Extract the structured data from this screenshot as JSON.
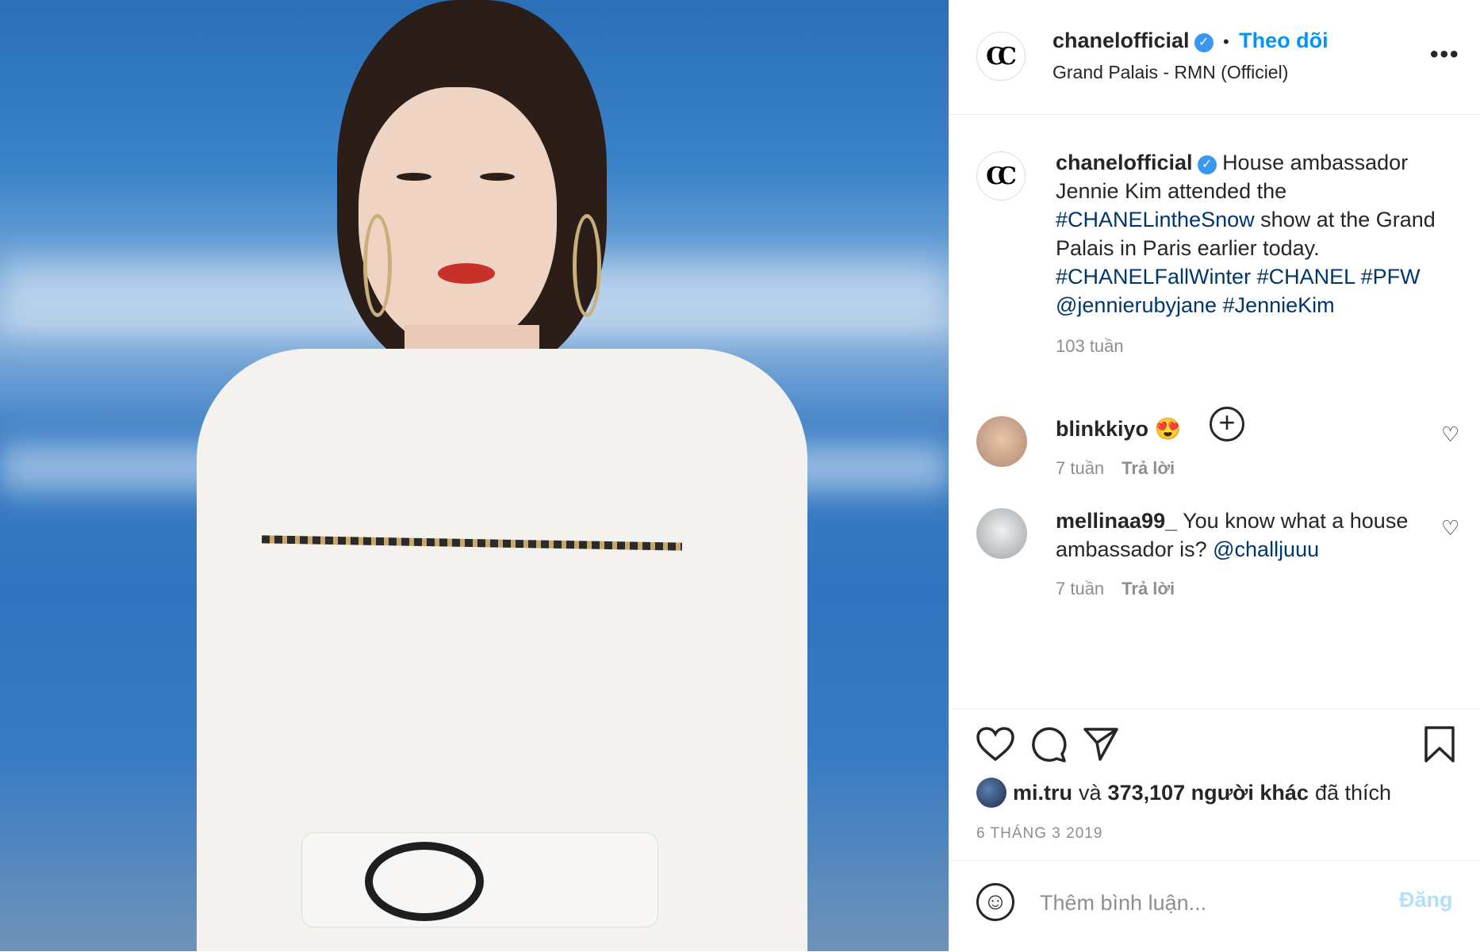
{
  "post": {
    "image_alt": "",
    "header": {
      "username": "chanelofficial",
      "separator": "•",
      "follow_label": "Theo dõi",
      "location": "Grand Palais - RMN (Officiel)",
      "more": "•••",
      "avatar_glyph": "CC"
    },
    "caption": {
      "username": "chanelofficial",
      "text_1": "House ambassador Jennie Kim attended the",
      "hashtag_1": "#CHANELintheSnow",
      "text_2": "show at the Grand Palais in Paris earlier today.",
      "hashtag_2": "#CHANELFallWinter",
      "hashtag_3": "#CHANEL",
      "hashtag_4": "#PFW",
      "mention": "@jennierubyjane",
      "hashtag_5": "#JennieKim",
      "time": "103 tuần"
    },
    "load_more": "+",
    "comments": [
      {
        "username": "blinkkiyo",
        "text": "😍",
        "time": "7 tuần",
        "reply": "Trả lời"
      },
      {
        "username": "mellinaa99_",
        "text": "You know what a house ambassador is?",
        "mention": "@challjuuu",
        "time": "7 tuần",
        "reply": "Trả lời"
      }
    ],
    "likes": {
      "first_user": "mi.tru",
      "conj": "và",
      "count_text": "373,107 người khác",
      "suffix": "đã thích"
    },
    "date": "6 THÁNG 3 2019",
    "add_comment": {
      "emoji": "☺",
      "placeholder": "Thêm bình luận...",
      "post_label": "Đăng"
    },
    "icons": {
      "like": "heart-icon",
      "comment": "comment-icon",
      "share": "share-icon",
      "save": "bookmark-icon"
    },
    "colors": {
      "accent": "#0095f6",
      "verified": "#3897f0",
      "hashtag": "#00376b",
      "muted": "#8e8e8e"
    }
  }
}
